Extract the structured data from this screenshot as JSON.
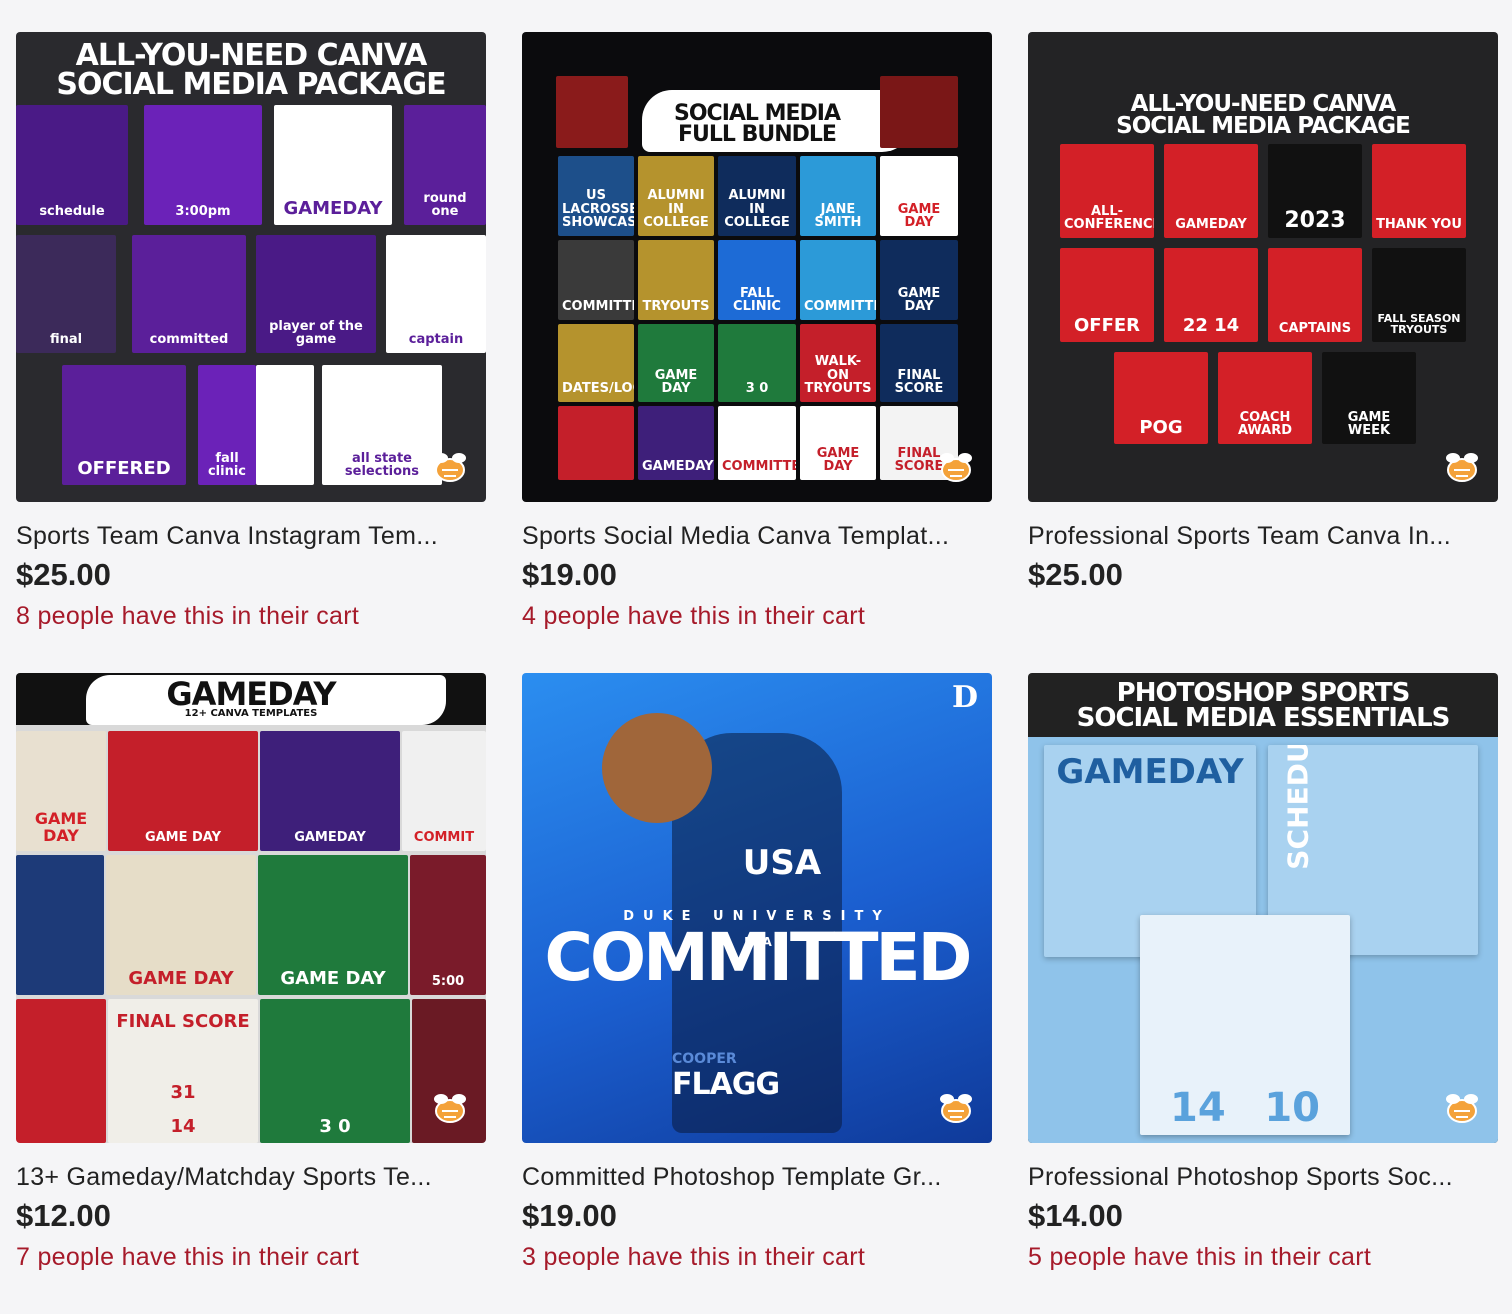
{
  "products": [
    {
      "title": "Sports Team Canva Instagram Tem...",
      "price": "$25.00",
      "cart_note": "8 people have this in their cart",
      "thumb": {
        "heading_line1": "ALL-YOU-NEED CANVA",
        "heading_line2": "SOCIAL MEDIA PACKAGE",
        "tile_labels": [
          "schedule",
          "3:00pm",
          "GAMEDAY",
          "round one",
          "final",
          "committed",
          "player of the game",
          "captain",
          "OFFERED",
          "fall clinic",
          "all state selections"
        ]
      }
    },
    {
      "title": "Sports Social Media Canva Templat...",
      "price": "$19.00",
      "cart_note": "4 people have this in their cart",
      "thumb": {
        "heading_line1": "SOCIAL MEDIA",
        "heading_line2": "FULL BUNDLE",
        "tile_labels": [
          "US LACROSSE SHOWCASE",
          "ALUMNI IN COLLEGE",
          "ALUMNI IN COLLEGE",
          "JANE SMITH",
          "GAME DAY",
          "COMMITTED",
          "TRYOUTS",
          "FALL CLINIC",
          "COMMITTED",
          "GAME DAY",
          "DATES/LOCATION",
          "GAME DAY",
          "3 0",
          "WALK-ON TRYOUTS",
          "FINAL SCORE",
          "GAMEDAY",
          "COMMITTED",
          "GAME DAY",
          "FINAL SCORE"
        ]
      }
    },
    {
      "title": "Professional Sports Team Canva In...",
      "price": "$25.00",
      "cart_note": "",
      "thumb": {
        "heading_line1": "ALL-YOU-NEED CANVA",
        "heading_line2": "SOCIAL MEDIA PACKAGE",
        "tile_labels": [
          "ALL-CONFERENCE",
          "GAMEDAY",
          "2023",
          "THANK YOU",
          "OFFER",
          "22 14",
          "CAPTAINS",
          "FALL SEASON TRYOUTS",
          "POG",
          "COACH AWARD",
          "GAME WEEK"
        ]
      }
    },
    {
      "title": "13+ Gameday/Matchday Sports Te...",
      "price": "$12.00",
      "cart_note": "7 people have this in their cart",
      "thumb": {
        "heading_line1": "GAMEDAY",
        "heading_line2": "12+ CANVA TEMPLATES",
        "tile_labels": [
          "GAME DAY",
          "GAME DAY",
          "GAMEDAY",
          "COMMIT",
          "GAME DAY",
          "GAME DAY",
          "5:00",
          "FINAL SCORE",
          "31",
          "14",
          "3 0"
        ]
      }
    },
    {
      "title": "Committed Photoshop Template Gr...",
      "price": "$19.00",
      "cart_note": "3 people have this in their cart",
      "thumb": {
        "heading_line1": "DUKE UNIVERSITY",
        "heading_line2": "COMMITTED",
        "tile_labels": [
          "USA",
          "USA",
          "COOPER",
          "FLAGG"
        ]
      }
    },
    {
      "title": "Professional Photoshop Sports Soc...",
      "price": "$14.00",
      "cart_note": "5 people have this in their cart",
      "thumb": {
        "heading_line1": "PHOTOSHOP SPORTS",
        "heading_line2": "SOCIAL MEDIA ESSENTIALS",
        "tile_labels": [
          "GAMEDAY",
          "SCHEDULE",
          "14",
          "10"
        ]
      }
    }
  ],
  "colors": {
    "page_bg": "#f5f5f7",
    "cart_text": "#a61a2a",
    "purple": "#5b1f9a",
    "red": "#d32027",
    "blue": "#1d6bd6",
    "carolina": "#8fc3ea"
  }
}
